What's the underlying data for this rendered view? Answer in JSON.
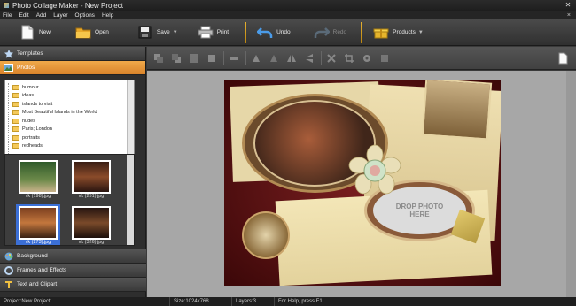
{
  "window": {
    "title": "Photo Collage Maker - New Project",
    "close_glyph": "✕"
  },
  "menu": {
    "items": [
      "File",
      "Edit",
      "Add",
      "Layer",
      "Options",
      "Help"
    ],
    "right_glyph": "×"
  },
  "toolbar": {
    "new_label": "New",
    "open_label": "Open",
    "save_label": "Save",
    "print_label": "Print",
    "undo_label": "Undo",
    "redo_label": "Redo",
    "products_label": "Products",
    "caret": "▼"
  },
  "left_panel": {
    "templates_label": "Templates",
    "photos_label": "Photos",
    "tree_items": [
      "humour",
      "ideas",
      "islands to visit",
      "Most Beautiful Islands in the World",
      "nudes",
      "Paris; London",
      "portraits",
      "redheads"
    ],
    "thumbnails": [
      {
        "caption": "vk (198).jpg",
        "selected": false
      },
      {
        "caption": "vk (251).jpg",
        "selected": false
      },
      {
        "caption": "vk (273).jpg",
        "selected": true
      },
      {
        "caption": "vk (326).jpg",
        "selected": false
      }
    ],
    "background_label": "Background",
    "frames_label": "Frames and Effects",
    "text_label": "Text and Clipart"
  },
  "canvas": {
    "drop_line1": "DROP PHOTO",
    "drop_line2": "HERE"
  },
  "status": {
    "project": "Project:New Project",
    "size": "Size:1024x768",
    "layers": "Layers:3",
    "help": "For Help, press F1."
  },
  "colors": {
    "accent_orange": "#e8932f",
    "selection_blue": "#3b6fd6",
    "toolbar_separator": "#e6b030"
  }
}
